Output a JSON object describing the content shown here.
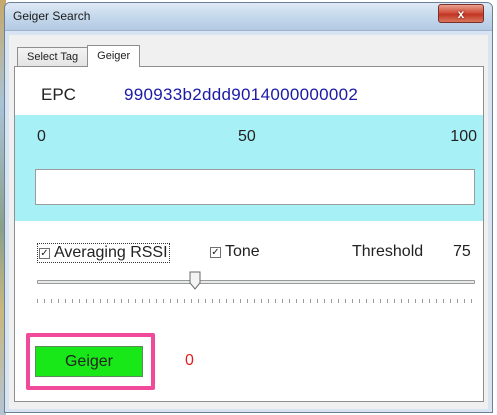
{
  "window": {
    "title": "Geiger Search",
    "close_label": "x"
  },
  "tabs": [
    {
      "label": "Select Tag",
      "active": false
    },
    {
      "label": "Geiger",
      "active": true
    }
  ],
  "epc": {
    "label": "EPC",
    "value": "990933b2ddd9014000000002"
  },
  "meter": {
    "tick_min": "0",
    "tick_mid": "50",
    "tick_max": "100",
    "level": 0
  },
  "options": {
    "averaging_rssi": {
      "label": "Averaging RSSI",
      "checked": true
    },
    "tone": {
      "label": "Tone",
      "checked": true
    },
    "threshold_label": "Threshold",
    "threshold_value": "75"
  },
  "slider": {
    "value": 0.36
  },
  "geiger_button": {
    "label": "Geiger"
  },
  "count": "0",
  "colors": {
    "meter_band": "#a7f1f6",
    "geiger_button": "#18e818",
    "epc_value": "#1a1aa6",
    "count": "#e02020",
    "highlight": "#f24a9a"
  }
}
